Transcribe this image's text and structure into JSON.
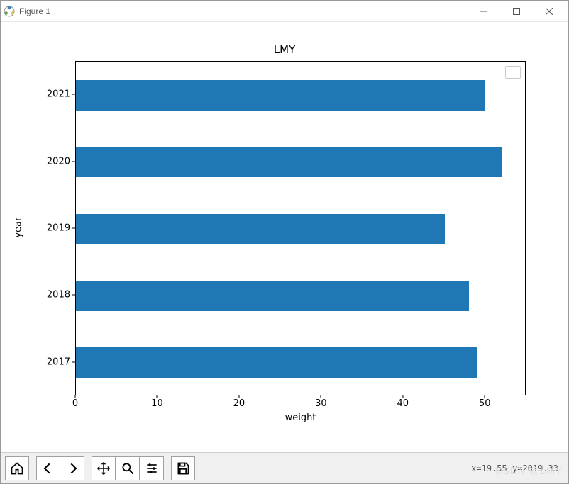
{
  "window": {
    "title": "Figure 1"
  },
  "chart_data": {
    "type": "bar",
    "orientation": "horizontal",
    "title": "LMY",
    "xlabel": "weight",
    "ylabel": "year",
    "xlim": [
      0,
      55
    ],
    "xticks": [
      0,
      10,
      20,
      30,
      40,
      50
    ],
    "categories": [
      "2017",
      "2018",
      "2019",
      "2020",
      "2021"
    ],
    "values": [
      49,
      48,
      45,
      52,
      50
    ],
    "legend_shown": true,
    "legend_entries": []
  },
  "status": {
    "coords": "x=19.55  y=2019.33"
  },
  "toolbar": {
    "home": "Home",
    "back": "Back",
    "forward": "Forward",
    "pan": "Pan",
    "zoom": "Zoom",
    "configure": "Configure subplots",
    "save": "Save"
  },
  "watermark": "CSDN @LMY"
}
